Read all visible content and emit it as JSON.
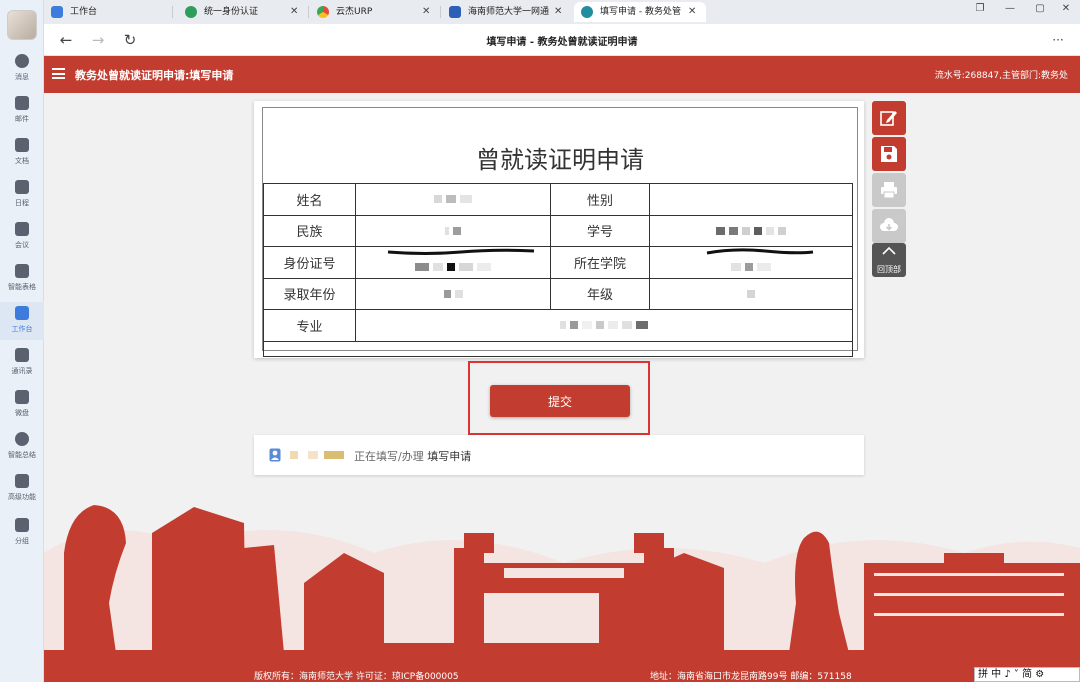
{
  "rail": {
    "items": [
      {
        "label": "消息",
        "icon": "message-icon"
      },
      {
        "label": "邮件",
        "icon": "mail-icon"
      },
      {
        "label": "文档",
        "icon": "document-icon"
      },
      {
        "label": "日程",
        "icon": "calendar-icon"
      },
      {
        "label": "会议",
        "icon": "meeting-icon"
      },
      {
        "label": "智能表格",
        "icon": "smart-table-icon"
      },
      {
        "label": "工作台",
        "icon": "workbench-icon"
      },
      {
        "label": "通讯录",
        "icon": "contacts-icon"
      },
      {
        "label": "微盘",
        "icon": "drive-icon"
      },
      {
        "label": "智能总结",
        "icon": "ai-summary-icon"
      },
      {
        "label": "高级功能",
        "icon": "advanced-icon"
      },
      {
        "label": "分组",
        "icon": "group-icon"
      }
    ],
    "active_index": 6
  },
  "tabs": [
    {
      "label": "工作台",
      "color": "#3d7bdc"
    },
    {
      "label": "统一身份认证",
      "color": "#2f9e5a"
    },
    {
      "label": "云杰URP",
      "color": "#e0a020"
    },
    {
      "label": "海南师范大学一网通",
      "color": "#2b5fb8"
    },
    {
      "label": "填写申请 - 教务处管",
      "color": "#1f8fa0"
    }
  ],
  "navbar": {
    "title": "填写申请 - 教务处曾就读证明申请",
    "more": "···"
  },
  "header": {
    "title": "教务处曾就读证明申请:填写申请",
    "right": "流水号:268847,主管部门:教务处"
  },
  "form": {
    "title": "曾就读证明申请",
    "labels": {
      "name": "姓名",
      "gender": "性别",
      "ethnicity": "民族",
      "student_id": "学号",
      "id_number": "身份证号",
      "college": "所在学院",
      "admission_year": "录取年份",
      "grade": "年级",
      "major": "专业"
    }
  },
  "tools": {
    "back_to_top": "回顶部"
  },
  "submit": {
    "label": "提交"
  },
  "status": {
    "prefix": "正在填写/办理",
    "step": "填写申请"
  },
  "footer": {
    "left": "版权所有：海南师范大学 许可证：琼ICP备000005",
    "right": "地址：海南省海口市龙昆南路99号 邮编：571158"
  },
  "ime": {
    "text": "拼 中 ♪ ˅ 简 ⚙"
  },
  "colors": {
    "brand_red": "#c23d30",
    "highlight_border": "#dd3333",
    "rail_active": "#3d7bdc"
  }
}
